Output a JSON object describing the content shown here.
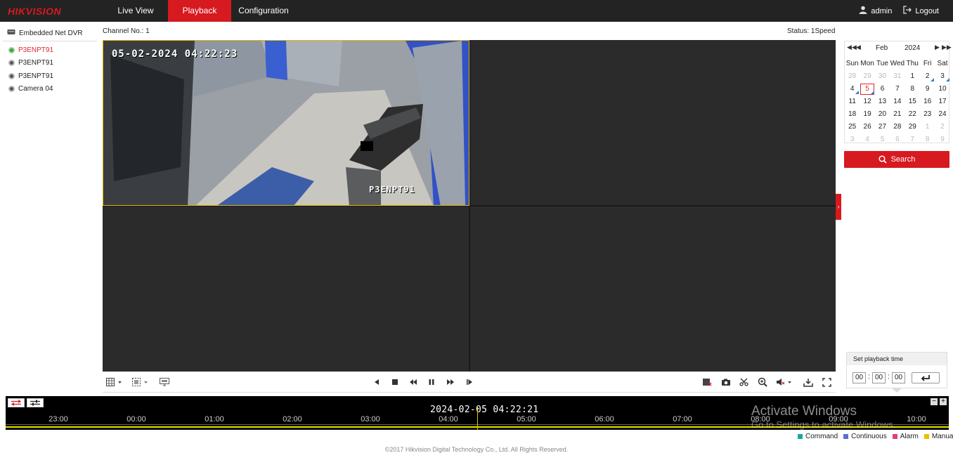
{
  "brand": {
    "logo": "HIKVISION",
    "accent": "#d71920"
  },
  "nav": {
    "tabs": [
      {
        "label": "Live View",
        "active": false
      },
      {
        "label": "Playback",
        "active": true
      },
      {
        "label": "Configuration",
        "active": false
      }
    ],
    "user": "admin",
    "logout": "Logout"
  },
  "device": {
    "title": "Embedded Net DVR",
    "cameras": [
      {
        "label": "P3ENPT91",
        "active": true
      },
      {
        "label": "P3ENPT91",
        "active": false
      },
      {
        "label": "P3ENPT91",
        "active": false
      },
      {
        "label": "Camera 04",
        "active": false
      }
    ]
  },
  "header": {
    "channel": "Channel No.: 1",
    "status": "Status: 1Speed"
  },
  "video": {
    "osd_time": "05-02-2024 04:22:23",
    "osd_name": "P3ENPT91"
  },
  "calendar": {
    "month": "Feb",
    "year": "2024",
    "weekdays": [
      "Sun",
      "Mon",
      "Tue",
      "Wed",
      "Thu",
      "Fri",
      "Sat"
    ],
    "weeks": [
      [
        "28",
        "29",
        "30",
        "31",
        "1",
        "2",
        "3"
      ],
      [
        "4",
        "5",
        "6",
        "7",
        "8",
        "9",
        "10"
      ],
      [
        "11",
        "12",
        "13",
        "14",
        "15",
        "16",
        "17"
      ],
      [
        "18",
        "19",
        "20",
        "21",
        "22",
        "23",
        "24"
      ],
      [
        "25",
        "26",
        "27",
        "28",
        "29",
        "1",
        "2"
      ],
      [
        "3",
        "4",
        "5",
        "6",
        "7",
        "8",
        "9"
      ]
    ],
    "today": "5",
    "recorded_days": [
      "2",
      "3",
      "4",
      "5"
    ]
  },
  "search": {
    "label": "Search"
  },
  "playback_time": {
    "title": "Set playback time",
    "hh": "00",
    "mm": "00",
    "ss": "00"
  },
  "timeline": {
    "current": "2024-02-05 04:22:21",
    "ticks": [
      "23:00",
      "00:00",
      "01:00",
      "02:00",
      "03:00",
      "04:00",
      "05:00",
      "06:00",
      "07:00",
      "08:00",
      "09:00",
      "10:00"
    ]
  },
  "legend": [
    {
      "label": "Command",
      "color": "#1aa89a"
    },
    {
      "label": "Continuous",
      "color": "#5b6fd6"
    },
    {
      "label": "Alarm",
      "color": "#e0407a"
    },
    {
      "label": "Manual",
      "color": "#e6c200"
    }
  ],
  "watermark": {
    "line1": "Activate Windows",
    "line2": "Go to Settings to activate Windows."
  },
  "footer": "©2017 Hikvision Digital Technology Co., Ltd. All Rights Reserved."
}
